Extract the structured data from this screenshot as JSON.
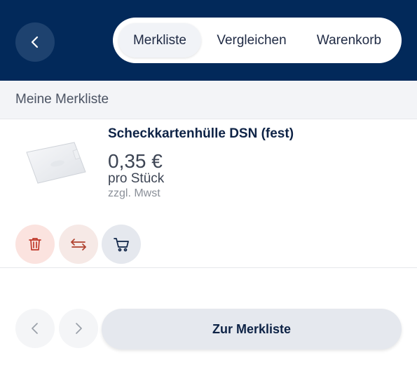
{
  "header": {
    "back_icon": "chevron-left-icon",
    "tabs": [
      {
        "label": "Merkliste",
        "active": true
      },
      {
        "label": "Vergleichen",
        "active": false
      },
      {
        "label": "Warenkorb",
        "active": false
      }
    ]
  },
  "section": {
    "title": "Meine Merkliste"
  },
  "item": {
    "name": "Scheckkartenhülle DSN (fest)",
    "price": "0,35 €",
    "unit": "pro Stück",
    "vat": "zzgl. Mwst",
    "actions": [
      {
        "icon": "trash-icon",
        "color": "#c0392b"
      },
      {
        "icon": "compare-arrows-icon",
        "color": "#b0412e"
      },
      {
        "icon": "cart-icon",
        "color": "#0e2346"
      }
    ]
  },
  "footer": {
    "prev_icon": "chevron-left-icon",
    "next_icon": "chevron-right-icon",
    "cta_label": "Zur Merkliste"
  },
  "colors": {
    "header_bg": "#02295a",
    "accent_dark": "#0e2346",
    "danger": "#c0392b"
  }
}
